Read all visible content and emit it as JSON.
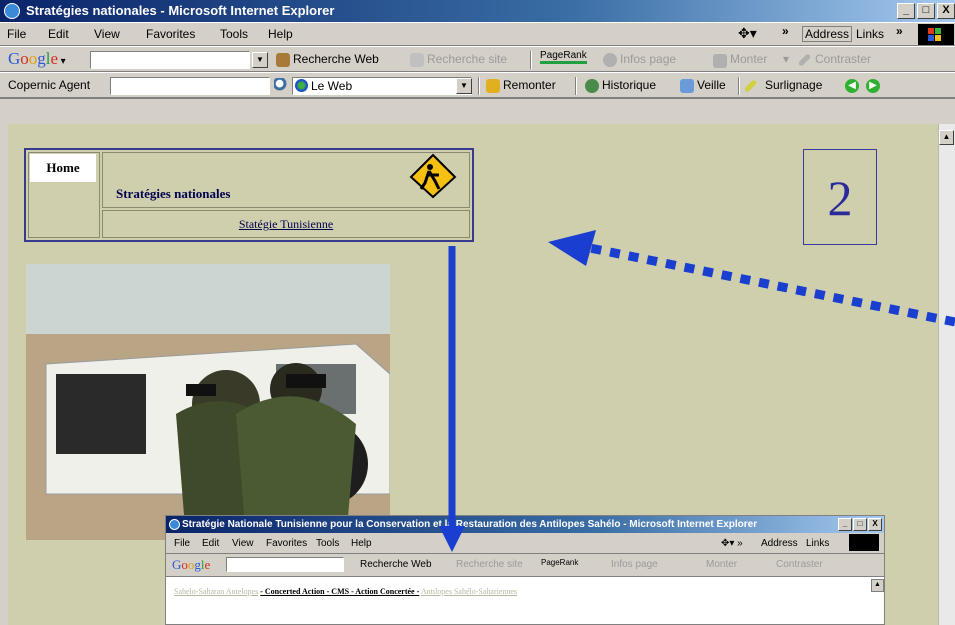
{
  "window": {
    "title": "Stratégies nationales - Microsoft Internet Explorer",
    "min": "_",
    "max": "□",
    "close": "X"
  },
  "menubar": {
    "items": [
      "File",
      "Edit",
      "View",
      "Favorites",
      "Tools",
      "Help"
    ],
    "address_label": "Address",
    "links_label": "Links",
    "chevron": "»"
  },
  "google_toolbar": {
    "logo": "Google",
    "web_search": "Recherche Web",
    "site_search": "Recherche site",
    "pagerank": "PageRank",
    "page_info": "Infos page",
    "up": "Monter",
    "contrast": "Contraster"
  },
  "copernic_toolbar": {
    "label": "Copernic Agent",
    "scope": "Le Web",
    "back_up": "Remonter",
    "history": "Historique",
    "watch": "Veille",
    "highlight": "Surlignage"
  },
  "page": {
    "home": "Home",
    "strategies": "Stratégies nationales",
    "tunisia_link": "Statégie Tunisienne",
    "slide_number": "2"
  },
  "inner_window": {
    "title": "Stratégie Nationale Tunisienne  pour la Conservation et la Restauration des  Antilopes Sahélo - Microsoft Internet Explorer",
    "menu": [
      "File",
      "Edit",
      "View",
      "Favorites",
      "Tools",
      "Help"
    ],
    "address_label": "Address",
    "links_label": "Links",
    "google": {
      "logo": "Google",
      "web_search": "Recherche Web",
      "site_search": "Recherche site",
      "pagerank": "PageRank",
      "page_info": "Infos page",
      "up": "Monter",
      "contrast": "Contraster"
    },
    "nav_left": "Sahelo-Saharan Antelopes",
    "nav_mid": "- Concerted Action - CMS - Action Concertée -",
    "nav_right": "Antilopes Sahélo-Sahariennes"
  },
  "colors": {
    "page_bg": "#cfcfae",
    "accent_blue": "#1a3fd0",
    "nav_border": "#3a3a8c"
  }
}
